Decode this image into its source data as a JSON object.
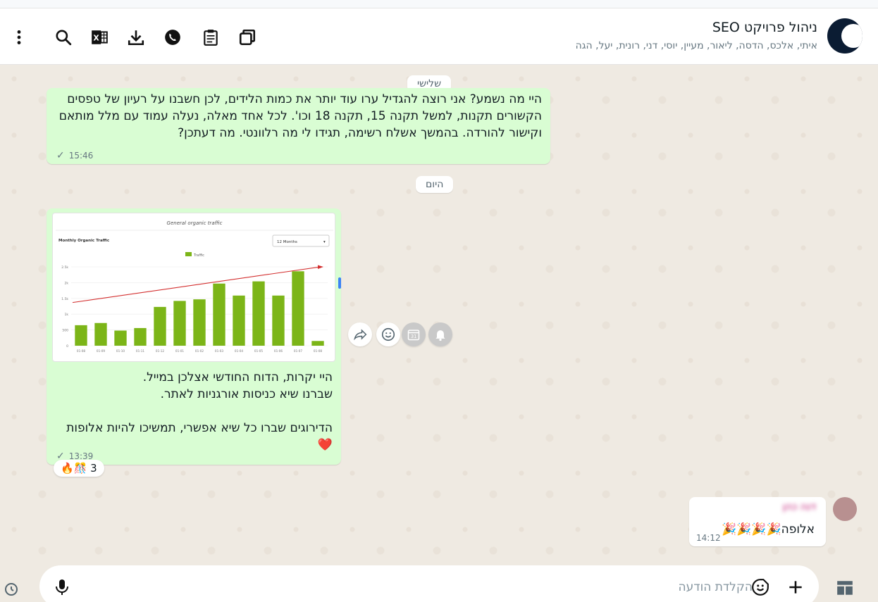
{
  "header": {
    "title": "ניהול פרויקט SEO",
    "subtitle": "איתי, אלכס, הדסה, ליאור, מעיין, יוסי, דני, רונית, יעל, הגה"
  },
  "toolbar": {
    "icons": [
      "menu-dots-icon",
      "search-icon",
      "excel-icon",
      "download-icon",
      "whatsapp-icon",
      "clipboard-icon",
      "copy-icon"
    ]
  },
  "chat": {
    "date_chip_top": "שלישי",
    "date_chip_mid": "היום",
    "msg1": {
      "text": "היי מה נשמע? אני רוצה להגדיל ערו עוד יותר את כמות הלידים, לכן חשבנו על רעיון של טפסים הקשורים תקנות, למשל תקנה 15, תקנה 18 וכו'. לכל אחד מאלה, נעלה עמוד עם מלל מותאם וקישור להורדה. בהמשך אשלח רשימה, תגידו לי מה רלוונטי. מה דעתכן?",
      "time": "15:46"
    },
    "msg2": {
      "text": "היי יקרות, הדוח החודשי אצלכן במייל.\nשברנו שיא כניסות אורגניות לאתר.\n\nהדירוגים שברו כל שיא אפשרי, תמשיכו להיות אלופות ❤️",
      "time": "13:39",
      "reactions": "🔥🎊 3"
    },
    "msg3": {
      "sender": "דנה כהן",
      "text": "אלופה🎉🎉🎉🎉",
      "time": "14:12"
    }
  },
  "chart_data": {
    "type": "bar",
    "title": "General organic traffic",
    "subtitle": "Monthly Organic Traffic",
    "dropdown": "12 Months",
    "legend": "Traffic",
    "categories": [
      "01-08",
      "01-09",
      "01-10",
      "01-11",
      "01-12",
      "01-01",
      "01-02",
      "01-03",
      "01-04",
      "01-05",
      "01-06",
      "01-07",
      "01-08"
    ],
    "values": [
      650,
      720,
      480,
      560,
      1230,
      1420,
      1470,
      1970,
      1590,
      2040,
      1590,
      2360,
      150
    ],
    "ylim": [
      0,
      2500
    ],
    "yticks": [
      "0",
      "500",
      "1k",
      "1.5k",
      "2k",
      "2.5k"
    ],
    "trend_line": true
  },
  "composer": {
    "placeholder": "הקלדת הודעה"
  },
  "colors": {
    "bubble_out": "#d9fdd3",
    "bar": "#7cb518",
    "trend": "#d32f2f"
  }
}
